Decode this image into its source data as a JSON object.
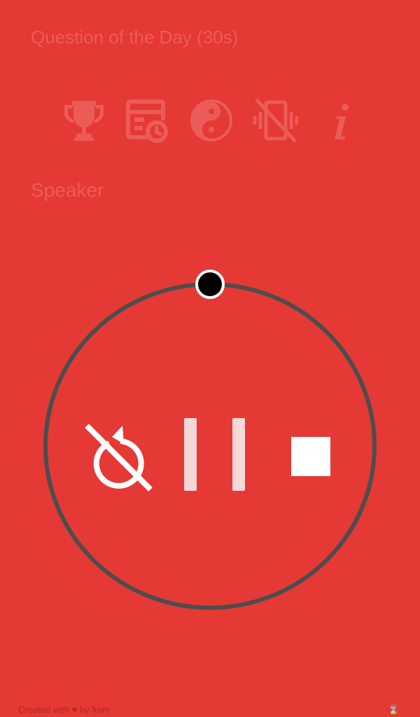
{
  "page": {
    "title": "Question of the Day (30s)",
    "speaker_label": "Speaker"
  },
  "toolbar": {
    "items": [
      {
        "icon": "trophy-icon"
      },
      {
        "icon": "schedule-icon"
      },
      {
        "icon": "yin-yang-icon"
      },
      {
        "icon": "vibration-off-icon"
      },
      {
        "icon": "info-icon"
      }
    ]
  },
  "timer": {
    "progress": 0,
    "controls": [
      {
        "icon": "loop-off-icon"
      },
      {
        "icon": "pause-icon"
      },
      {
        "icon": "stop-icon"
      }
    ]
  },
  "footer": {
    "text_created": "Created with ♥ by",
    "author": "",
    "text_from": "from",
    "source": "",
    "mark": "⌛"
  },
  "colors": {
    "background": "#e53935",
    "faded_text": "#eb5c59",
    "ring": "#4d4d4d",
    "knob": "#000000",
    "controls": "#ffffff"
  }
}
